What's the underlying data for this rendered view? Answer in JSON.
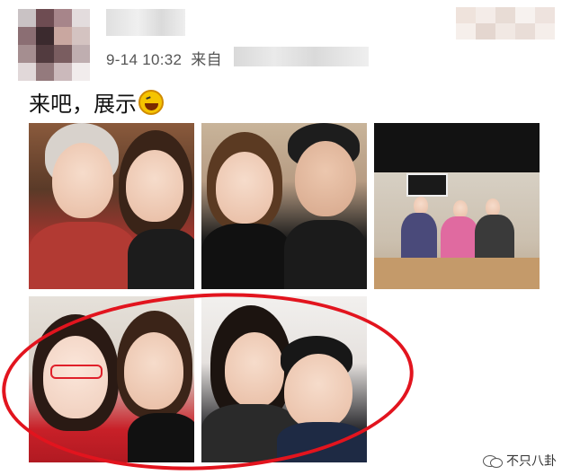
{
  "post": {
    "timestamp": "9-14 10:32",
    "source_prefix": "来自",
    "text": "来吧，展示"
  },
  "icons": {
    "emoji": "laughing-crying-emoji",
    "watermark": "wechat-icon"
  },
  "watermark": {
    "label": "不只八卦"
  },
  "colors": {
    "highlight": "#e2141e"
  }
}
